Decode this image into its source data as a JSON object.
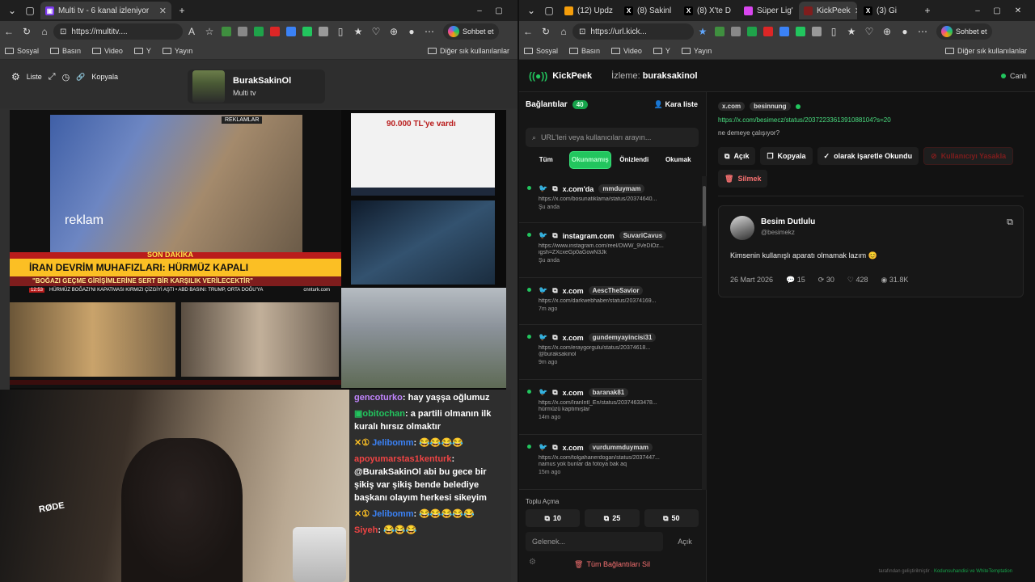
{
  "left_browser": {
    "tab": {
      "title": "Multi tv - 6 kanal izleniyor"
    },
    "url": "https://multitv....",
    "bookmarks": [
      "Sosyal",
      "Basın",
      "Video",
      "Y",
      "Yayın"
    ],
    "other_favorites": "Diğer sık kullanılanlar",
    "chat_button": "Sohbet et"
  },
  "right_browser": {
    "tabs": [
      {
        "title": "(12) Updz",
        "color": "#f59e0b"
      },
      {
        "title": "(8) Sakinl",
        "color": "#000000"
      },
      {
        "title": "(8) X'te D",
        "color": "#000000"
      },
      {
        "title": "Süper Lig'",
        "color": "#d946ef"
      },
      {
        "title": "KickPeek",
        "color": "#7f1d1d"
      },
      {
        "title": "(3) Gi",
        "color": "#000000"
      }
    ],
    "url": "https://url.kick...",
    "bookmarks": [
      "Sosyal",
      "Basın",
      "Video",
      "Y",
      "Yayın"
    ],
    "other_favorites": "Diğer sık kullanılanlar",
    "chat_button": "Sohbet et"
  },
  "multitv": {
    "controls": [
      "Liste",
      "Kopyala"
    ],
    "channel_name": "BurakSakinOl",
    "channel_sub": "Multi tv",
    "news": {
      "reklamlar": "REKLAMLAR",
      "reklam": "reklam",
      "son_dakika": "SON DAKİKA",
      "headline": "İRAN DEVRİM MUHAFIZLARI: HÜRMÜZ KAPALI",
      "subline": "\"BOĞAZI GEÇME GİRİŞİMLERİNE SERT BİR KARŞILIK VERİLECEKTİR\"",
      "time": "12:53",
      "ticker": "HÜRMÜZ BOĞAZI'NI KAPATMASI KIRMIZI ÇİZGİYİ AŞTI  •  ABD BASINI: TRUMP, ORTA DOĞU'YA",
      "channel": "cnnturk.com"
    },
    "price_text": "90.000 TL'ye vardı"
  },
  "chat": [
    {
      "user": "gencoturko",
      "color": "#c084fc",
      "text": "hay yaşşa oğlumuz"
    },
    {
      "user": "obitochan",
      "color": "#22c55e",
      "text": "a partili olmanın ilk kuralı hırsız olmaktır"
    },
    {
      "user": "Jelibomm",
      "color": "#3b82f6",
      "text": "😂😂😂😂"
    },
    {
      "user": "apoyumarstas1kenturk",
      "color": "#ef4444",
      "text": "@BurakSakinOl abi bu gece bir şikiş var şikiş bende belediye başkanı olayım herkesi sikeyim"
    },
    {
      "user": "Jelibomm",
      "color": "#3b82f6",
      "text": "😂😂😂😂😂"
    },
    {
      "user": "Siyeh",
      "color": "#ef4444",
      "text": "😂😂😂"
    }
  ],
  "kickpeek": {
    "brand": "KickPeek",
    "watch_label": "İzleme:",
    "watch_user": "buraksakinol",
    "live_label": "Canlı",
    "connections_title": "Bağlantılar",
    "connections_count": "40",
    "blacklist": "Kara liste",
    "search_placeholder": "URL'leri veya kullanıcıları arayın...",
    "filters": [
      "Tüm",
      "Okunmamış",
      "Önizlendi",
      "Okumak"
    ],
    "items": [
      {
        "site": "x.com'da",
        "user": "mmduymam",
        "link": "https://x.com/bosunatiklama/status/20374640...",
        "extra": "",
        "time": "Şu anda"
      },
      {
        "site": "instagram.com",
        "user": "SuvariCavus",
        "link": "https://www.instagram.com/reel/DWW_9VeDlOz...",
        "extra": "igsh=ZXcxeGp0aGowN3Jk",
        "time": "Şu anda"
      },
      {
        "site": "x.com",
        "user": "AescTheSavior",
        "link": "https://x.com/darkwebhaber/status/20374169...",
        "extra": "",
        "time": "7m ago"
      },
      {
        "site": "x.com",
        "user": "gundemyayincisi31",
        "link": "https://x.com/eraygorgulu/status/20374618...",
        "extra": "@buraksakinol",
        "time": "9m ago"
      },
      {
        "site": "x.com",
        "user": "baranak81",
        "link": "https://x.com/IranIntl_En/status/20374633478...",
        "extra": "hürmüzü kaptımışlar",
        "time": "14m ago"
      },
      {
        "site": "x.com",
        "user": "vurdummduymam",
        "link": "https://x.com/tolgahanerdogan/status/2037447...",
        "extra": "namus yok bunlar da fotoya bak aq",
        "time": "15m ago"
      }
    ],
    "bulk_title": "Toplu Açma",
    "bulk": [
      "10",
      "25",
      "50"
    ],
    "skip_placeholder": "Gelenek...",
    "skip_button": "Açık",
    "delete_all": "Tüm Bağlantıları Sil",
    "detail": {
      "site": "x.com",
      "user": "besinnung",
      "url": "https://x.com/besimecz/status/2037223361391088104?s=20",
      "note": "ne demeye çalışıyor?",
      "actions": [
        "Açık",
        "Kopyala",
        "olarak işaretle Okundu",
        "Kullanıcıyı Yasakla",
        "Silmek"
      ]
    },
    "tweet": {
      "name": "Besim Dutlulu",
      "handle": "@besimekz",
      "text": "Kimsenin kullanışlı aparatı olmamak lazım 😊",
      "date": "26 Mart 2026",
      "replies": "15",
      "retweets": "30",
      "likes": "428",
      "views": "31.8K"
    },
    "footer_prefix": "tarafından geliştirilmiştir",
    "footer_names": "Kodunsuhandisi ve WhiteTemptation"
  }
}
